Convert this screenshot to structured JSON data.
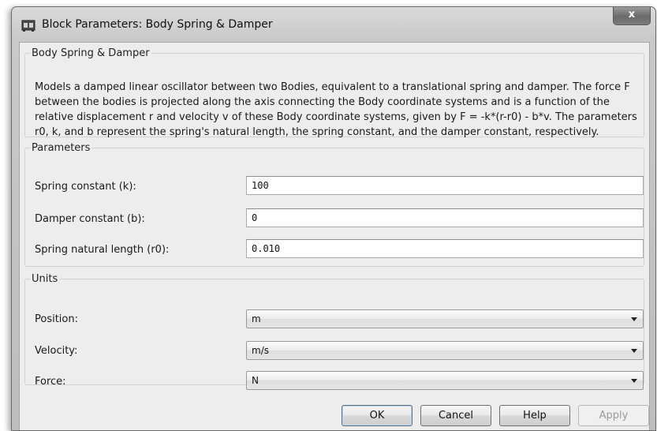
{
  "window": {
    "title": "Block Parameters: Body Spring & Damper",
    "close_label": "x"
  },
  "description": {
    "group_title": "Body Spring & Damper",
    "text": "Models a damped linear oscillator between two Bodies, equivalent to a translational spring and damper. The force F between the bodies is projected along the axis connecting the Body coordinate systems and is a function of the relative displacement r and velocity v of these Body coordinate systems, given by F = -k*(r-r0) - b*v. The parameters r0, k, and b represent the spring's natural length, the spring constant, and the damper constant, respectively."
  },
  "parameters": {
    "group_title": "Parameters",
    "spring_constant": {
      "label": "Spring constant (k):",
      "value": "100"
    },
    "damper_constant": {
      "label": "Damper constant (b):",
      "value": "0"
    },
    "natural_length": {
      "label": "Spring natural length (r0):",
      "value": "0.010"
    }
  },
  "units": {
    "group_title": "Units",
    "position": {
      "label": "Position:",
      "selected": "m"
    },
    "velocity": {
      "label": "Velocity:",
      "selected": "m/s"
    },
    "force": {
      "label": "Force:",
      "selected": "N"
    }
  },
  "buttons": {
    "ok": "OK",
    "cancel": "Cancel",
    "help": "Help",
    "apply": "Apply"
  },
  "icons": {
    "app": "simulink-block-icon",
    "close": "close-icon",
    "dropdown": "chevron-down-icon"
  }
}
